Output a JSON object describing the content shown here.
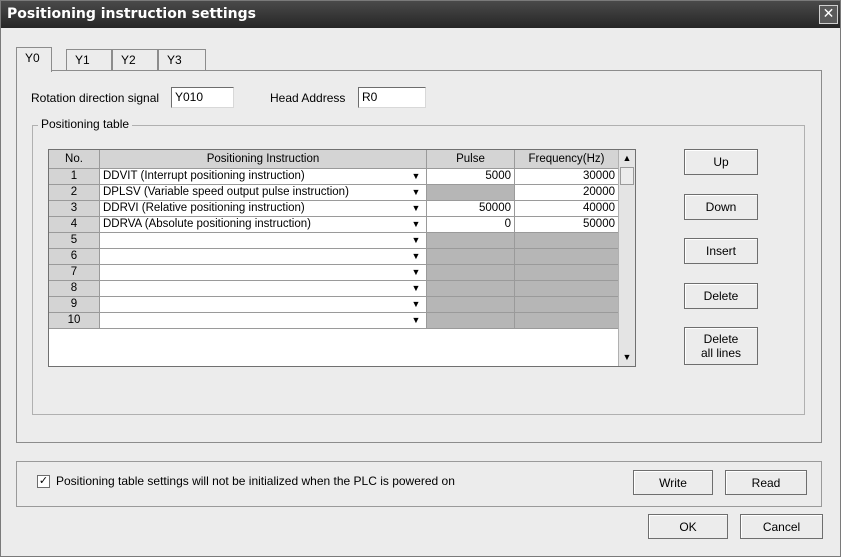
{
  "window": {
    "title": "Positioning instruction settings",
    "close_glyph": "✕"
  },
  "tabs": [
    {
      "label": "Y0",
      "active": true
    },
    {
      "label": "Y1",
      "active": false
    },
    {
      "label": "Y2",
      "active": false
    },
    {
      "label": "Y3",
      "active": false
    }
  ],
  "rotation": {
    "label": "Rotation direction signal",
    "value": "Y010"
  },
  "head_address": {
    "label": "Head Address",
    "value": "R0"
  },
  "table": {
    "group_title": "Positioning table",
    "headers": {
      "no": "No.",
      "instruction": "Positioning Instruction",
      "pulse": "Pulse",
      "frequency": "Frequency(Hz)"
    },
    "rows": [
      {
        "no": "1",
        "instruction": "DDVIT (Interrupt positioning instruction)",
        "pulse": "5000",
        "frequency": "30000"
      },
      {
        "no": "2",
        "instruction": "DPLSV (Variable speed output pulse instruction)",
        "pulse": "",
        "frequency": "20000"
      },
      {
        "no": "3",
        "instruction": "DDRVI (Relative positioning instruction)",
        "pulse": "50000",
        "frequency": "40000"
      },
      {
        "no": "4",
        "instruction": "DDRVA (Absolute positioning instruction)",
        "pulse": "0",
        "frequency": "50000"
      },
      {
        "no": "5",
        "instruction": "",
        "pulse": "",
        "frequency": ""
      },
      {
        "no": "6",
        "instruction": "",
        "pulse": "",
        "frequency": ""
      },
      {
        "no": "7",
        "instruction": "",
        "pulse": "",
        "frequency": ""
      },
      {
        "no": "8",
        "instruction": "",
        "pulse": "",
        "frequency": ""
      },
      {
        "no": "9",
        "instruction": "",
        "pulse": "",
        "frequency": ""
      },
      {
        "no": "10",
        "instruction": "",
        "pulse": "",
        "frequency": ""
      }
    ],
    "dropdown_glyph": "▼",
    "scroll_up_glyph": "▲",
    "scroll_down_glyph": "▼"
  },
  "side_buttons": {
    "up": "Up",
    "down": "Down",
    "insert": "Insert",
    "delete": "Delete",
    "delete_all_line1": "Delete",
    "delete_all_line2": "all lines"
  },
  "footer": {
    "checkbox_label": "Positioning table settings will not be initialized when the PLC is powered on",
    "checkbox_checked": true,
    "check_glyph": "✓",
    "write": "Write",
    "read": "Read",
    "ok": "OK",
    "cancel": "Cancel"
  },
  "colors": {
    "title_bar": "#333333",
    "dialog_bg": "#ececec",
    "disabled_cell": "#b6b6b6"
  }
}
